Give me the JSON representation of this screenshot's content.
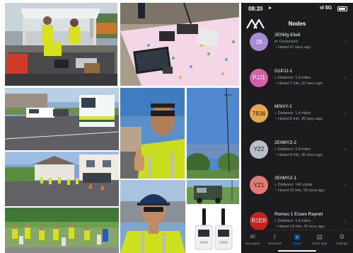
{
  "photos": [
    {
      "name": "photo-gazebo-radio-station"
    },
    {
      "name": "photo-table-radios"
    },
    {
      "name": "photo-street-van"
    },
    {
      "name": "photo-selfie-hivis-thumbsup"
    },
    {
      "name": "photo-tall-antenna-mast"
    },
    {
      "name": "photo-runners-street"
    },
    {
      "name": "photo-landrover"
    },
    {
      "name": "photo-marshals-park"
    },
    {
      "name": "photo-man-cap-sunglasses"
    },
    {
      "name": "photo-meshtastic-devices"
    }
  ],
  "phone": {
    "status": {
      "time": "08:20",
      "signal": "ııl 5G"
    },
    "title": "Nodes",
    "nodes": [
      {
        "short": "28",
        "color": "#a78ad8",
        "text_color": "#ffffff",
        "name": "2E0kfg 83e8",
        "line1": "Connected",
        "line1_ok": true,
        "line2": "Heard 47 secs ago"
      },
      {
        "short": "PJJ1",
        "color": "#d65fa8",
        "text_color": "#ffffff",
        "name": "G1PJJ-1",
        "line1": "Distance: 1.3 miles",
        "line1_ok": false,
        "line2": "Heard 7 min, 32 secs ago"
      },
      {
        "short": "7B36",
        "color": "#e3a84c",
        "text_color": "#1c1c1e",
        "name": "M0IXY-1",
        "line1": "Distance: 1.4 miles",
        "line1_ok": false,
        "line2": "Heard 8 min, 35 secs ago"
      },
      {
        "short": "YZ2",
        "color": "#b9bfc8",
        "text_color": "#1c1c1e",
        "name": "2E0MYZ-2",
        "line1": "Distance: 0.8 miles",
        "line1_ok": false,
        "line2": "Heard 8 min, 35 secs ago"
      },
      {
        "short": "YZ1",
        "color": "#e07a72",
        "text_color": "#1c1c1e",
        "name": "2E0MYZ-1",
        "line1": "Distance: 140 yards",
        "line1_ok": false,
        "line2": "Heard 10 min, 59 secs ago"
      },
      {
        "short": "R1ER",
        "color": "#c8241f",
        "text_color": "#ffffff",
        "name": "Romeo 1 Essex Raynet",
        "line1": "Distance: 1.6 miles",
        "line1_ok": false,
        "line2": "Heard 13 min, 42 secs ago"
      }
    ],
    "tabs": [
      {
        "label": "Messages",
        "icon": "messages-icon",
        "glyph": "✉"
      },
      {
        "label": "Bluetooth",
        "icon": "bluetooth-icon",
        "glyph": "ᛒ"
      },
      {
        "label": "Nodes",
        "icon": "nodes-icon",
        "glyph": "▣",
        "active": true
      },
      {
        "label": "Mesh Map",
        "icon": "map-icon",
        "glyph": "▤"
      },
      {
        "label": "Settings",
        "icon": "gear-icon",
        "glyph": "⚙"
      }
    ]
  }
}
